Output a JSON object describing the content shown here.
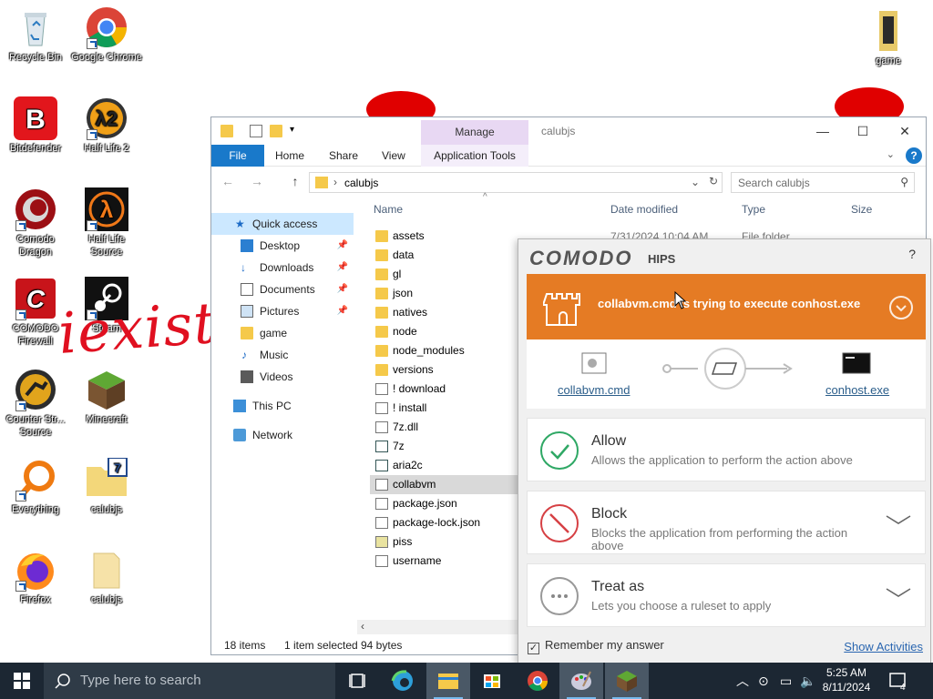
{
  "desktop": {
    "icons": [
      {
        "label": "Recycle Bin"
      },
      {
        "label": "Google Chrome"
      },
      {
        "label": "Bitdefender"
      },
      {
        "label": "Half Life 2"
      },
      {
        "label": "Comodo Dragon"
      },
      {
        "label": "Half Life Source"
      },
      {
        "label": "COMODO Firewall"
      },
      {
        "label": "Steam"
      },
      {
        "label": "Counter Str... Source"
      },
      {
        "label": "Minecraft"
      },
      {
        "label": "Everything"
      },
      {
        "label": "calubjs"
      },
      {
        "label": "Firefox"
      },
      {
        "label": "calubjs"
      },
      {
        "label": "game"
      }
    ],
    "graffiti": "iexist"
  },
  "explorer": {
    "title": "calubjs",
    "manage_tab": "Manage",
    "ribbon_tabs": [
      "File",
      "Home",
      "Share",
      "View",
      "Application Tools"
    ],
    "address": "calubjs",
    "search_placeholder": "Search calubjs",
    "columns": [
      "Name",
      "Date modified",
      "Type",
      "Size"
    ],
    "first_row_date": "7/31/2024 10:04 AM",
    "first_row_type": "File folder",
    "nav": {
      "quick_access": "Quick access",
      "items": [
        "Desktop",
        "Downloads",
        "Documents",
        "Pictures",
        "game",
        "Music",
        "Videos"
      ],
      "this_pc": "This PC",
      "network": "Network"
    },
    "files": [
      "assets",
      "data",
      "gl",
      "json",
      "natives",
      "node",
      "node_modules",
      "versions",
      "! download",
      "! install",
      "7z.dll",
      "7z",
      "aria2c",
      "collabvm",
      "package.json",
      "package-lock.json",
      "piss",
      "username"
    ],
    "status": {
      "count": "18 items",
      "selected": "1 item selected",
      "size": "94 bytes"
    }
  },
  "comodo": {
    "brand": "COMODO",
    "product": "HIPS",
    "help": "?",
    "alert": "collabvm.cmd is trying to execute conhost.exe",
    "source": "collabvm.cmd",
    "target": "conhost.exe",
    "options": [
      {
        "title": "Allow",
        "desc": "Allows the application to perform the action above"
      },
      {
        "title": "Block",
        "desc": "Blocks the application from performing the action above"
      },
      {
        "title": "Treat as",
        "desc": "Lets you choose a ruleset to apply"
      }
    ],
    "remember": "Remember my answer",
    "show_activities": "Show Activities"
  },
  "taskbar": {
    "search_placeholder": "Type here to search",
    "time": "5:25 AM",
    "date": "8/11/2024",
    "notifications": "4"
  }
}
